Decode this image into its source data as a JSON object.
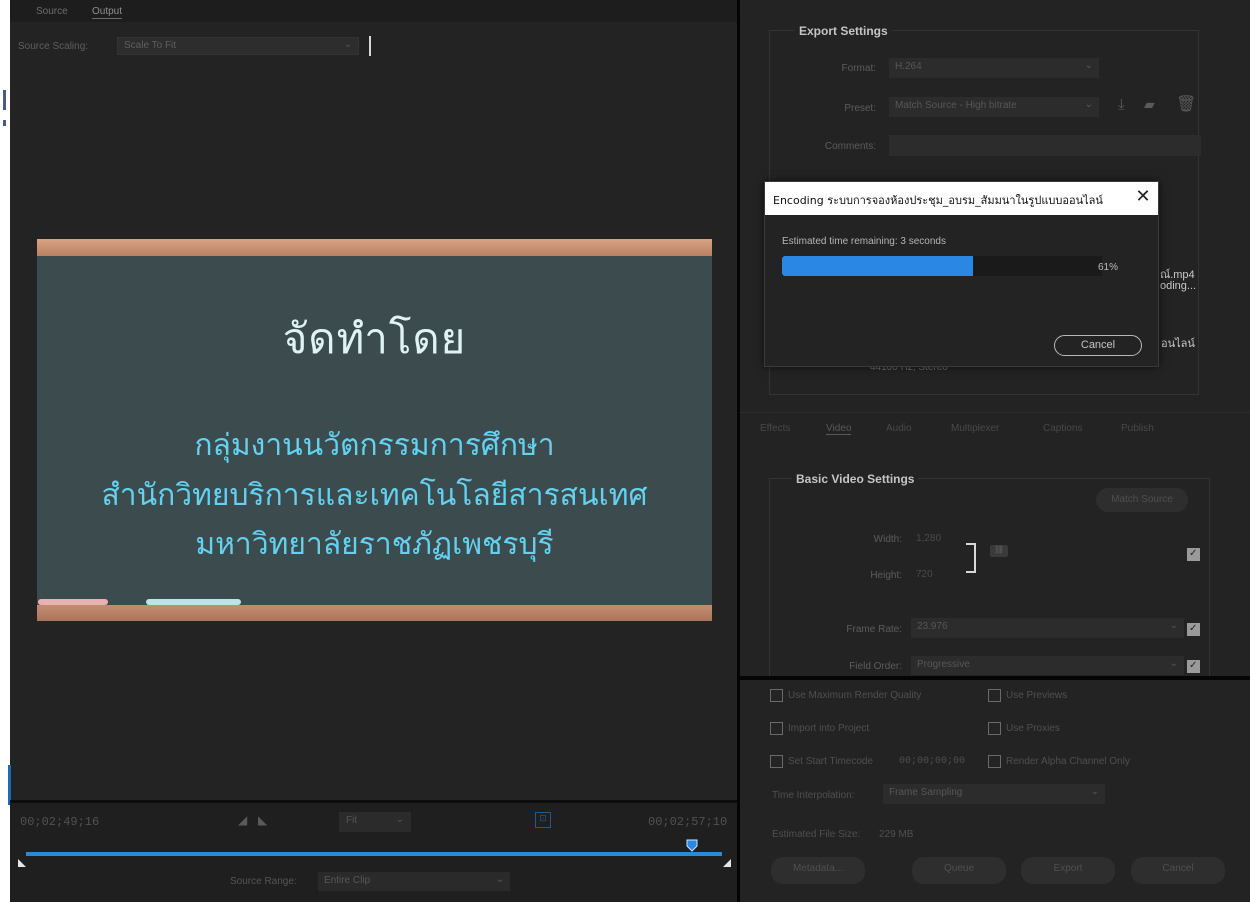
{
  "left": {
    "tabs": [
      "Source",
      "Output"
    ],
    "source_scaling_label": "Source Scaling:",
    "source_scaling_value": "Scale To Fit",
    "slide": {
      "title": "จัดทำโดย",
      "lines": [
        "กลุ่มงานนวัตกรรมการศึกษา",
        "สำนักวิทยบริการและเทคโนโลยีสารสนเทศ",
        "มหาวิทยาลัยราชภัฏเพชรบุรี"
      ]
    },
    "timecode_start": "00;02;49;16",
    "timecode_end": "00;02;57;10",
    "fit_label": "Fit",
    "source_range_label": "Source Range:",
    "source_range_value": "Entire Clip"
  },
  "export_settings": {
    "title": "Export Settings",
    "format_label": "Format:",
    "format_value": "H.264",
    "preset_label": "Preset:",
    "preset_value": "Match Source - High bitrate",
    "comments_label": "Comments:",
    "peek_filename": "ณ์.mp4",
    "peek_encoding": "oding...",
    "peek_online": "อนไลน์",
    "peek_audio": "44100 Hz, Stereo"
  },
  "panel_tabs": [
    "Effects",
    "Video",
    "Audio",
    "Multiplexer",
    "Captions",
    "Publish"
  ],
  "basic_video": {
    "title": "Basic Video Settings",
    "match_source": "Match Source",
    "width_label": "Width:",
    "width_value": "1,280",
    "height_label": "Height:",
    "height_value": "720",
    "frame_rate_label": "Frame Rate:",
    "frame_rate_value": "23.976",
    "field_order_label": "Field Order:",
    "field_order_value": "Progressive"
  },
  "options": {
    "max_render_quality": "Use Maximum Render Quality",
    "use_previews": "Use Previews",
    "import_into_project": "Import into Project",
    "use_proxies": "Use Proxies",
    "set_start_timecode": "Set Start Timecode",
    "start_timecode_value": "00;00;00;00",
    "render_alpha": "Render Alpha Channel Only",
    "time_interp_label": "Time Interpolation:",
    "time_interp_value": "Frame Sampling",
    "est_file_size_label": "Estimated File Size:",
    "est_file_size_value": "229 MB"
  },
  "buttons": {
    "metadata": "Metadata...",
    "queue": "Queue",
    "export": "Export",
    "cancel": "Cancel"
  },
  "dialog": {
    "title": "Encoding ระบบการจองห้องประชุม_อบรม_สัมมนาในรูปแบบออนไลน์",
    "close": "✕",
    "estimated": "Estimated time remaining: 3 seconds",
    "progress": 0.61,
    "percent_text": "61%",
    "cancel": "Cancel"
  },
  "colors": {
    "accent": "#2b87e4",
    "slide_bg": "#3c4b4d",
    "slide_text": "#63d1f0"
  }
}
